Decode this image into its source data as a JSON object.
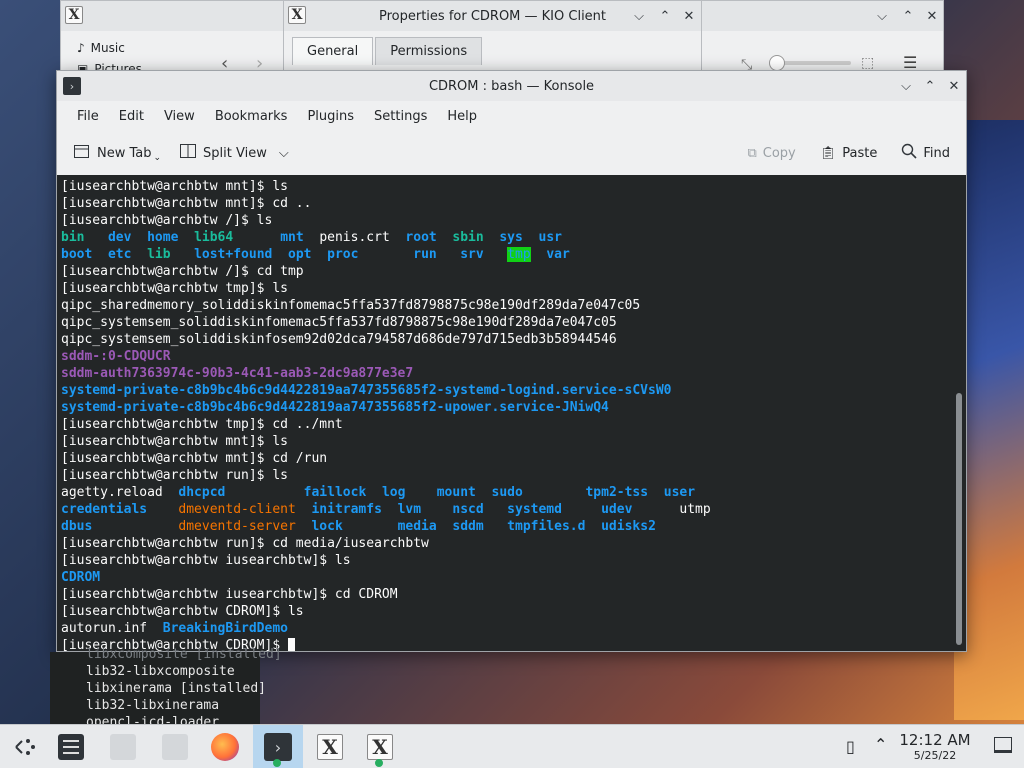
{
  "bg_windows": {
    "left_places": [
      "Music",
      "Pictures"
    ],
    "kio_title": "Properties for CDROM — KIO Client",
    "kio_tabs": [
      "General",
      "Permissions"
    ]
  },
  "konsole": {
    "title": "CDROM : bash — Konsole",
    "menu": [
      "File",
      "Edit",
      "View",
      "Bookmarks",
      "Plugins",
      "Settings",
      "Help"
    ],
    "toolbar": {
      "new_tab": "New Tab",
      "split_view": "Split View",
      "copy": "Copy",
      "paste": "Paste",
      "find": "Find"
    }
  },
  "terminal": {
    "lines": [
      [
        {
          "t": "[iusearchbtw@archbtw mnt]$ ls",
          "c": "white"
        }
      ],
      [
        {
          "t": "[iusearchbtw@archbtw mnt]$ cd ..",
          "c": "white"
        }
      ],
      [
        {
          "t": "[iusearchbtw@archbtw /]$ ls",
          "c": "white"
        }
      ],
      [
        {
          "t": "bin",
          "c": "cyan"
        },
        {
          "t": "   ",
          "c": "white"
        },
        {
          "t": "dev",
          "c": "blue"
        },
        {
          "t": "  ",
          "c": "white"
        },
        {
          "t": "home",
          "c": "blue"
        },
        {
          "t": "  ",
          "c": "white"
        },
        {
          "t": "lib64",
          "c": "cyan"
        },
        {
          "t": "      ",
          "c": "white"
        },
        {
          "t": "mnt",
          "c": "blue"
        },
        {
          "t": "  penis.crt  ",
          "c": "white"
        },
        {
          "t": "root",
          "c": "blue"
        },
        {
          "t": "  ",
          "c": "white"
        },
        {
          "t": "sbin",
          "c": "cyan"
        },
        {
          "t": "  ",
          "c": "white"
        },
        {
          "t": "sys",
          "c": "blue"
        },
        {
          "t": "  ",
          "c": "white"
        },
        {
          "t": "usr",
          "c": "blue"
        }
      ],
      [
        {
          "t": "boot",
          "c": "blue"
        },
        {
          "t": "  ",
          "c": "white"
        },
        {
          "t": "etc",
          "c": "blue"
        },
        {
          "t": "  ",
          "c": "white"
        },
        {
          "t": "lib",
          "c": "cyan"
        },
        {
          "t": "   ",
          "c": "white"
        },
        {
          "t": "lost+found",
          "c": "blue"
        },
        {
          "t": "  ",
          "c": "white"
        },
        {
          "t": "opt",
          "c": "blue"
        },
        {
          "t": "  ",
          "c": "white"
        },
        {
          "t": "proc",
          "c": "blue"
        },
        {
          "t": "       ",
          "c": "white"
        },
        {
          "t": "run",
          "c": "blue"
        },
        {
          "t": "   ",
          "c": "white"
        },
        {
          "t": "srv",
          "c": "blue"
        },
        {
          "t": "   ",
          "c": "white"
        },
        {
          "t": "tmp",
          "c": "tmp"
        },
        {
          "t": "  ",
          "c": "white"
        },
        {
          "t": "var",
          "c": "blue"
        }
      ],
      [
        {
          "t": "[iusearchbtw@archbtw /]$ cd tmp",
          "c": "white"
        }
      ],
      [
        {
          "t": "[iusearchbtw@archbtw tmp]$ ls",
          "c": "white"
        }
      ],
      [
        {
          "t": "qipc_sharedmemory_soliddiskinfomemac5ffa537fd8798875c98e190df289da7e047c05",
          "c": "white"
        }
      ],
      [
        {
          "t": "qipc_systemsem_soliddiskinfomemac5ffa537fd8798875c98e190df289da7e047c05",
          "c": "white"
        }
      ],
      [
        {
          "t": "qipc_systemsem_soliddiskinfosem92d02dca794587d686de797d715edb3b58944546",
          "c": "white"
        }
      ],
      [
        {
          "t": "sddm-:0-CDQUCR",
          "c": "purple"
        }
      ],
      [
        {
          "t": "sddm-auth7363974c-90b3-4c41-aab3-2dc9a877e3e7",
          "c": "purple"
        }
      ],
      [
        {
          "t": "systemd-private-c8b9bc4b6c9d4422819aa747355685f2-systemd-logind.service-sCVsW0",
          "c": "blue"
        }
      ],
      [
        {
          "t": "systemd-private-c8b9bc4b6c9d4422819aa747355685f2-upower.service-JNiwQ4",
          "c": "blue"
        }
      ],
      [
        {
          "t": "[iusearchbtw@archbtw tmp]$ cd ../mnt",
          "c": "white"
        }
      ],
      [
        {
          "t": "[iusearchbtw@archbtw mnt]$ ls",
          "c": "white"
        }
      ],
      [
        {
          "t": "[iusearchbtw@archbtw mnt]$ cd /run",
          "c": "white"
        }
      ],
      [
        {
          "t": "[iusearchbtw@archbtw run]$ ls",
          "c": "white"
        }
      ],
      [
        {
          "t": "agetty.reload  ",
          "c": "white"
        },
        {
          "t": "dhcpcd",
          "c": "blue"
        },
        {
          "t": "          ",
          "c": "white"
        },
        {
          "t": "faillock",
          "c": "blue"
        },
        {
          "t": "  ",
          "c": "white"
        },
        {
          "t": "log",
          "c": "blue"
        },
        {
          "t": "    ",
          "c": "white"
        },
        {
          "t": "mount",
          "c": "blue"
        },
        {
          "t": "  ",
          "c": "white"
        },
        {
          "t": "sudo",
          "c": "blue"
        },
        {
          "t": "        ",
          "c": "white"
        },
        {
          "t": "tpm2-tss",
          "c": "blue"
        },
        {
          "t": "  ",
          "c": "white"
        },
        {
          "t": "user",
          "c": "blue"
        }
      ],
      [
        {
          "t": "credentials",
          "c": "blue"
        },
        {
          "t": "    ",
          "c": "white"
        },
        {
          "t": "dmeventd-client",
          "c": "orange"
        },
        {
          "t": "  ",
          "c": "white"
        },
        {
          "t": "initramfs",
          "c": "blue"
        },
        {
          "t": "  ",
          "c": "white"
        },
        {
          "t": "lvm",
          "c": "blue"
        },
        {
          "t": "    ",
          "c": "white"
        },
        {
          "t": "nscd",
          "c": "blue"
        },
        {
          "t": "   ",
          "c": "white"
        },
        {
          "t": "systemd",
          "c": "blue"
        },
        {
          "t": "     ",
          "c": "white"
        },
        {
          "t": "udev",
          "c": "blue"
        },
        {
          "t": "      utmp",
          "c": "white"
        }
      ],
      [
        {
          "t": "dbus",
          "c": "blue"
        },
        {
          "t": "           ",
          "c": "white"
        },
        {
          "t": "dmeventd-server",
          "c": "orange"
        },
        {
          "t": "  ",
          "c": "white"
        },
        {
          "t": "lock",
          "c": "blue"
        },
        {
          "t": "       ",
          "c": "white"
        },
        {
          "t": "media",
          "c": "blue"
        },
        {
          "t": "  ",
          "c": "white"
        },
        {
          "t": "sddm",
          "c": "blue"
        },
        {
          "t": "   ",
          "c": "white"
        },
        {
          "t": "tmpfiles.d",
          "c": "blue"
        },
        {
          "t": "  ",
          "c": "white"
        },
        {
          "t": "udisks2",
          "c": "blue"
        }
      ],
      [
        {
          "t": "[iusearchbtw@archbtw run]$ cd media/iusearchbtw",
          "c": "white"
        }
      ],
      [
        {
          "t": "[iusearchbtw@archbtw iusearchbtw]$ ls",
          "c": "white"
        }
      ],
      [
        {
          "t": "CDROM",
          "c": "blue"
        }
      ],
      [
        {
          "t": "[iusearchbtw@archbtw iusearchbtw]$ cd CDROM",
          "c": "white"
        }
      ],
      [
        {
          "t": "[iusearchbtw@archbtw CDROM]$ ls",
          "c": "white"
        }
      ],
      [
        {
          "t": "autorun.inf  ",
          "c": "white"
        },
        {
          "t": "BreakingBirdDemo",
          "c": "blue"
        }
      ],
      [
        {
          "t": "[iusearchbtw@archbtw CDROM]$ ",
          "c": "white"
        }
      ]
    ]
  },
  "under_terminal": {
    "lines": [
      "libxcomposite [installed]",
      "lib32-libxcomposite",
      "libxinerama [installed]",
      "lib32-libxinerama",
      "opencl-icd-loader"
    ]
  },
  "taskbar": {
    "time": "12:12 AM",
    "date": "5/25/22"
  },
  "colors": {
    "terminal_bg": "#232627",
    "blue": "#1d99f3",
    "cyan": "#1abc9c",
    "purple": "#9b59b6",
    "orange": "#f67400",
    "green": "#11d116"
  }
}
